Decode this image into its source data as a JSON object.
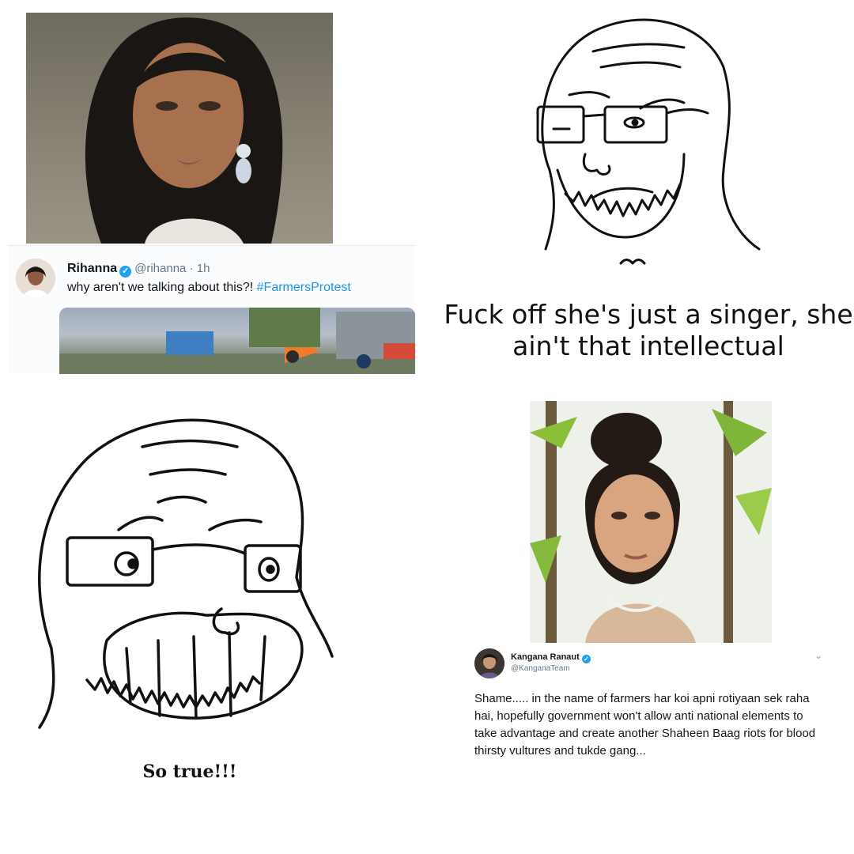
{
  "tweet_1": {
    "name": "Rihanna",
    "handle": "@rihanna · 1h",
    "text": "why aren't we talking about this?! ",
    "hashtag": "#FarmersProtest"
  },
  "caption_1": "Fuck off she's just a singer, she ain't that intellectual",
  "caption_2": "So true!!!",
  "tweet_2": {
    "name": "Kangana Ranaut",
    "handle": "@KanganaTeam",
    "text": "Shame..... in the name of farmers har koi apni rotiyaan sek raha hai, hopefully government won't allow anti national elements to take advantage and create another Shaheen Baag riots for blood thirsty vultures and tukde gang..."
  },
  "icons": {
    "verified": "verified-badge-icon",
    "chevron": "chevron-down-icon"
  },
  "colors": {
    "verified_blue": "#1da1f2",
    "hashtag_blue": "#1b95e0"
  }
}
